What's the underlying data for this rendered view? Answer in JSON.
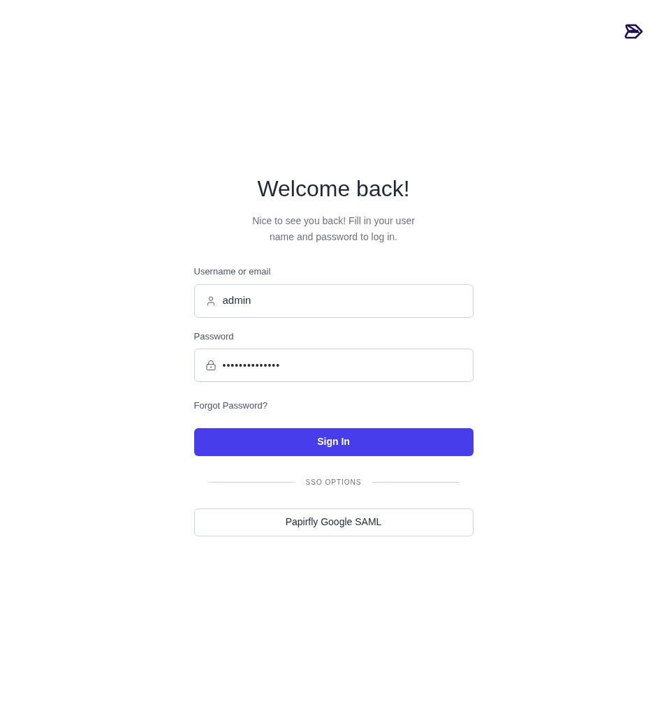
{
  "title": "Welcome back!",
  "subtitle": "Nice to see you back! Fill in your user name and password to log in.",
  "fields": [
    {
      "kind": "user",
      "label": "Username or email",
      "value": "admin"
    },
    {
      "kind": "password",
      "label": "Password",
      "value": "••••••••••••••"
    }
  ],
  "forgot_link": "Forgot Password?",
  "sign_in_button": "Sign In",
  "divider_label": "SSO OPTIONS",
  "sso_buttons": [
    "Papirfly Google SAML"
  ]
}
